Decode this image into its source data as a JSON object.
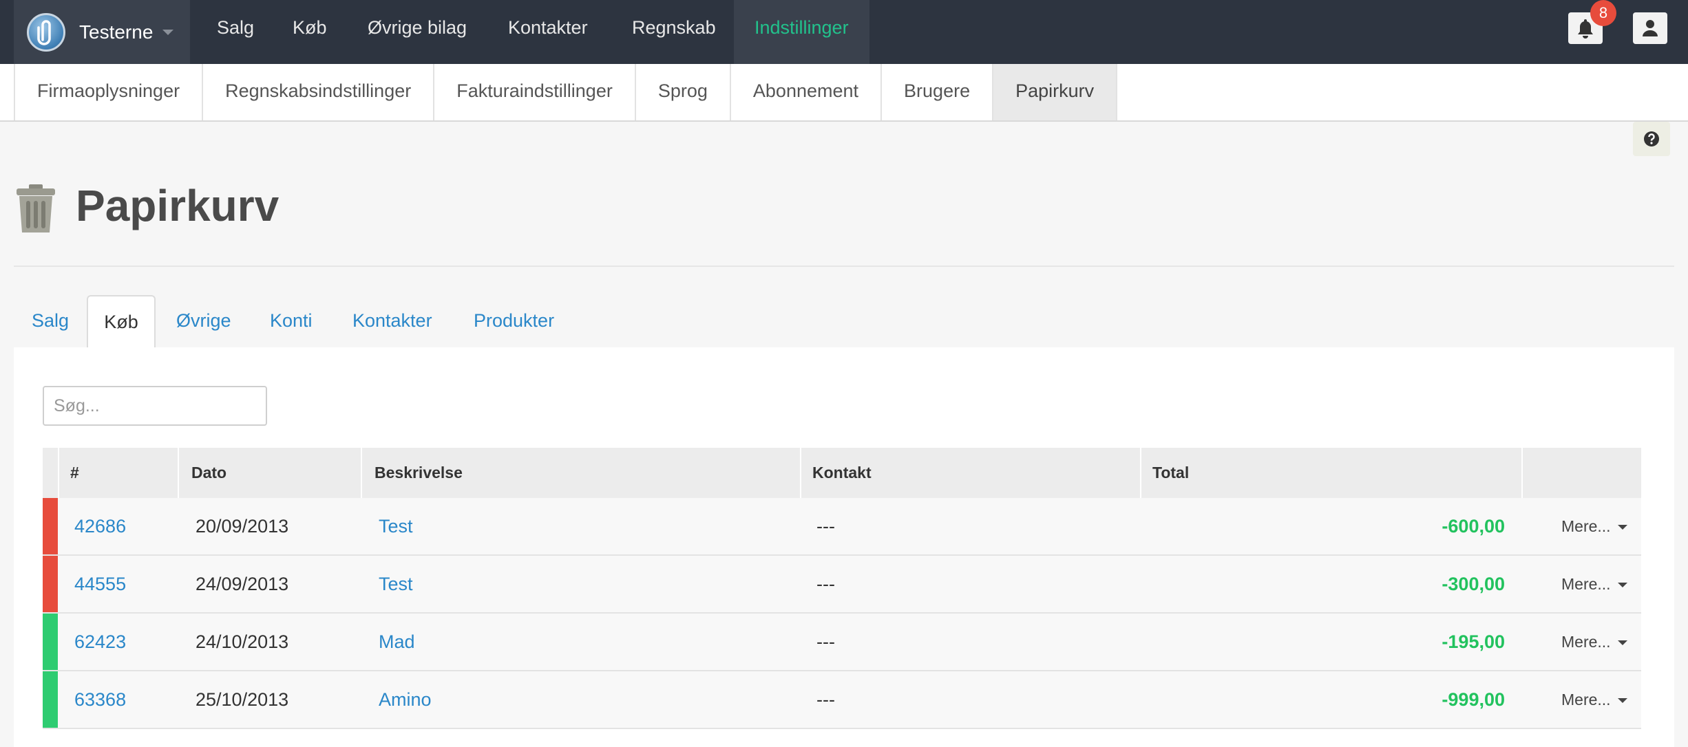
{
  "topnav": {
    "brand": "Testerne",
    "items": [
      "Salg",
      "Køb",
      "Øvrige bilag",
      "Kontakter",
      "Regnskab",
      "Indstillinger"
    ],
    "active": "Indstillinger",
    "notifications_count": "8"
  },
  "subnav": {
    "items": [
      "Firmaoplysninger",
      "Regnskabsindstillinger",
      "Fakturaindstillinger",
      "Sprog",
      "Abonnement",
      "Brugere",
      "Papirkurv"
    ],
    "active": "Papirkurv"
  },
  "page": {
    "title": "Papirkurv"
  },
  "tabs": {
    "items": [
      "Salg",
      "Køb",
      "Øvrige",
      "Konti",
      "Kontakter",
      "Produkter"
    ],
    "active": "Køb"
  },
  "search": {
    "placeholder": "Søg..."
  },
  "table": {
    "headers": [
      "#",
      "Dato",
      "Beskrivelse",
      "Kontakt",
      "Total"
    ],
    "more_label": "Mere...",
    "rows": [
      {
        "number": "42686",
        "date": "20/09/2013",
        "description": "Test",
        "contact": "---",
        "total": "-600,00",
        "status_color": "#e74c3c"
      },
      {
        "number": "44555",
        "date": "24/09/2013",
        "description": "Test",
        "contact": "---",
        "total": "-300,00",
        "status_color": "#e74c3c"
      },
      {
        "number": "62423",
        "date": "24/10/2013",
        "description": "Mad",
        "contact": "---",
        "total": "-195,00",
        "status_color": "#2ecc71"
      },
      {
        "number": "63368",
        "date": "25/10/2013",
        "description": "Amino",
        "contact": "---",
        "total": "-999,00",
        "status_color": "#2ecc71"
      }
    ]
  },
  "colors": {
    "topbar": "#2d3440",
    "accent": "#22c28c",
    "link": "#2a87c9",
    "total": "#22c25e"
  }
}
